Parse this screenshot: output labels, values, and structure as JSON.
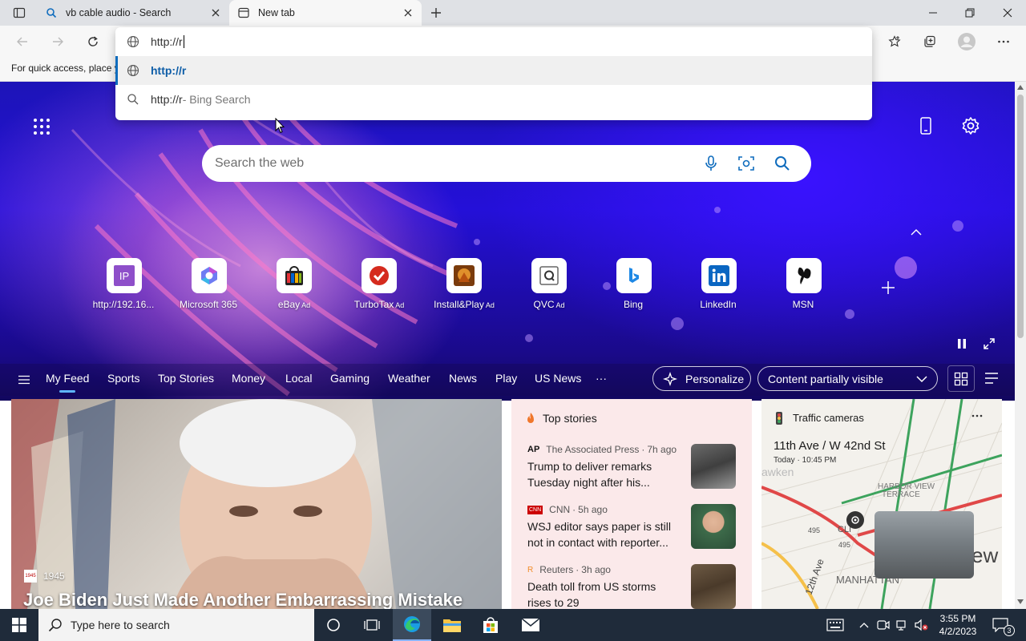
{
  "tabs": [
    {
      "title": "vb cable audio - Search",
      "icon": "bing-search-icon"
    },
    {
      "title": "New tab",
      "icon": "new-tab-page-icon"
    }
  ],
  "address_bar": {
    "typed_value": "http://r",
    "suggestions": [
      {
        "text": "http://r",
        "suffix": "",
        "icon": "globe-icon"
      },
      {
        "text": "http://r",
        "suffix": " - Bing Search",
        "icon": "search-icon"
      }
    ]
  },
  "favorites_hint": "For quick access, place y",
  "search": {
    "placeholder": "Search the web"
  },
  "quick_links": [
    {
      "label": "http://192.16...",
      "ad": "",
      "icon": "ip-icon"
    },
    {
      "label": "Microsoft 365",
      "ad": "",
      "icon": "microsoft-365-icon"
    },
    {
      "label": "eBay",
      "ad": "Ad",
      "icon": "ebay-icon"
    },
    {
      "label": "TurboTax",
      "ad": "Ad",
      "icon": "turbotax-icon"
    },
    {
      "label": "Install&Play",
      "ad": "Ad",
      "icon": "install-play-icon"
    },
    {
      "label": "QVC",
      "ad": "Ad",
      "icon": "qvc-icon"
    },
    {
      "label": "Bing",
      "ad": "",
      "icon": "bing-icon"
    },
    {
      "label": "LinkedIn",
      "ad": "",
      "icon": "linkedin-icon"
    },
    {
      "label": "MSN",
      "ad": "",
      "icon": "msn-icon"
    }
  ],
  "feed_nav": {
    "items": [
      "My Feed",
      "Sports",
      "Top Stories",
      "Money",
      "Local",
      "Gaming",
      "Weather",
      "News",
      "Play",
      "US News"
    ],
    "more": "···",
    "personalize": "Personalize",
    "visibility": "Content partially visible"
  },
  "main_card": {
    "source": "1945",
    "source_badge": "1945",
    "headline": "Joe Biden Just Made Another Embarrassing Mistake"
  },
  "top_stories": {
    "title": "Top stories",
    "items": [
      {
        "badge": "AP",
        "source": "The Associated Press",
        "age": "7h ago",
        "headline": "Trump to deliver remarks Tuesday night after his..."
      },
      {
        "badge": "CNN",
        "source": "CNN",
        "age": "5h ago",
        "headline": "WSJ editor says paper is still not in contact with reporter..."
      },
      {
        "badge": "R",
        "source": "Reuters",
        "age": "3h ago",
        "headline": "Death toll from US storms rises to 29"
      }
    ]
  },
  "traffic": {
    "title": "Traffic cameras",
    "location": "11th Ave / W 42nd St",
    "time": "Today · 10:45 PM",
    "map_labels": [
      "HARBOR VIEW",
      "TERRACE",
      "MANHATTAN",
      "495",
      "495",
      "12th Ave",
      "awken",
      "CLI",
      "ew"
    ]
  },
  "taskbar": {
    "search_placeholder": "Type here to search",
    "time": "3:55 PM",
    "date": "4/2/2023",
    "notifications": "3"
  },
  "colors": {
    "accent": "#0f6cbd",
    "hero": "#2410d8",
    "taskbar": "#1f2b3a"
  }
}
